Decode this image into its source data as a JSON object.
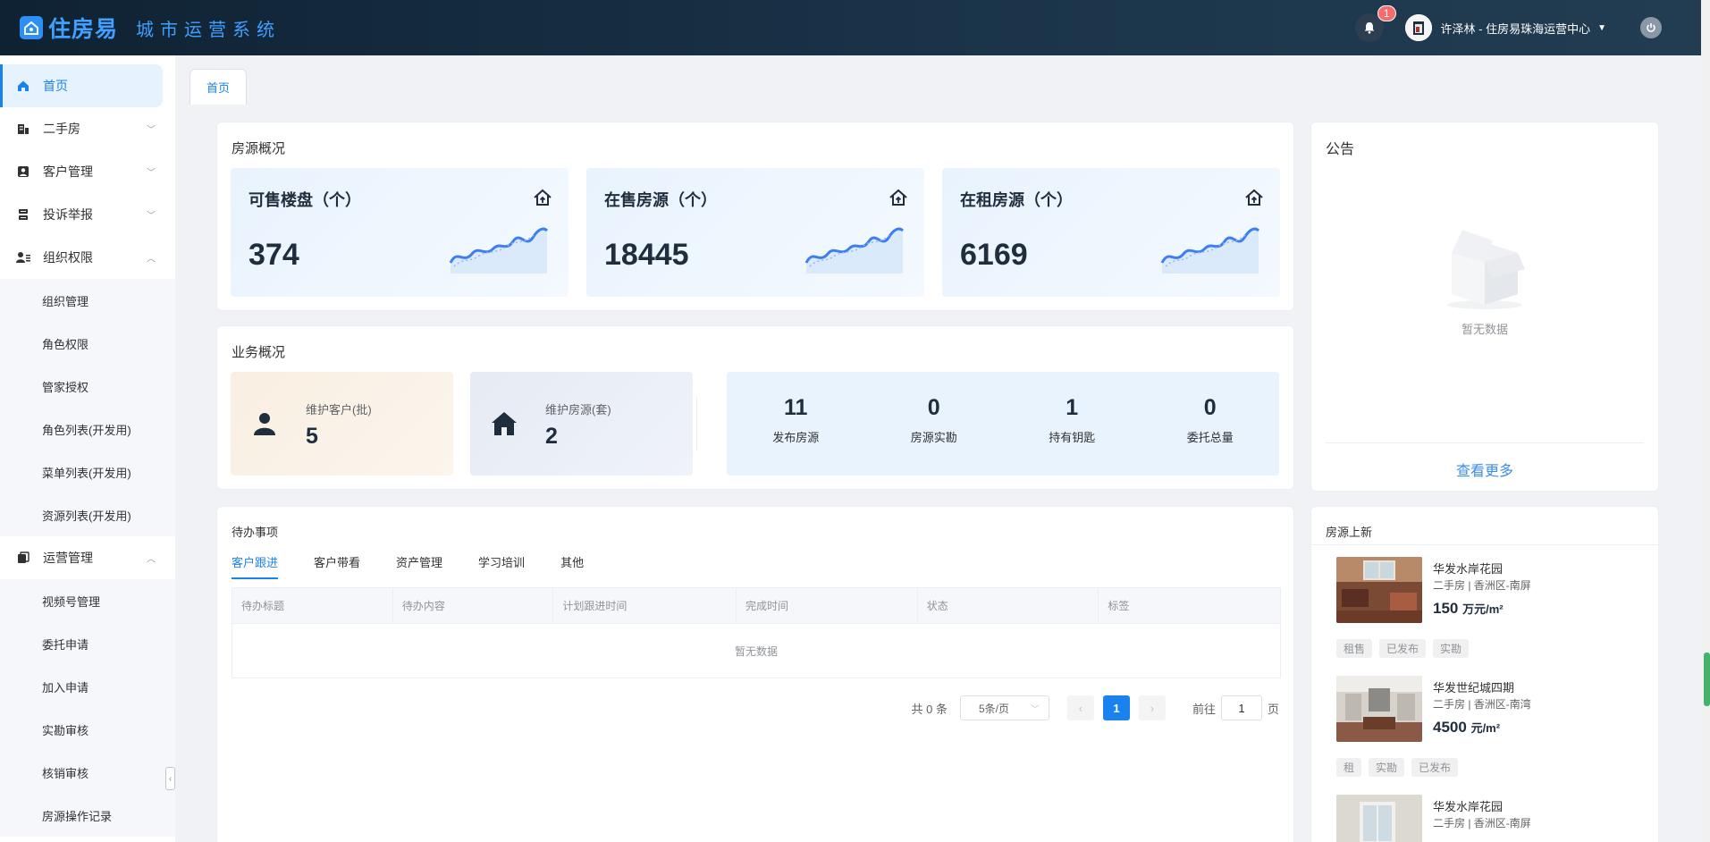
{
  "header": {
    "logo_text": "住房易",
    "system_name": "城市运营系统",
    "notification_count": "1",
    "user_label": "许泽林 - 住房易珠海运营中心"
  },
  "sidebar": {
    "items": [
      {
        "label": "首页",
        "icon": "home-icon",
        "active": true
      },
      {
        "label": "二手房",
        "icon": "building-icon"
      },
      {
        "label": "客户管理",
        "icon": "contact-card-icon"
      },
      {
        "label": "投诉举报",
        "icon": "complaint-icon"
      },
      {
        "label": "组织权限",
        "icon": "user-group-icon",
        "expanded": true
      }
    ],
    "org_sub": [
      "组织管理",
      "角色权限",
      "管家授权",
      "角色列表(开发用)",
      "菜单列表(开发用)",
      "资源列表(开发用)"
    ],
    "ops": {
      "label": "运营管理",
      "icon": "copy-icon"
    },
    "ops_sub": [
      "视频号管理",
      "委托申请",
      "加入申请",
      "实勘审核",
      "核销审核",
      "房源操作记录"
    ]
  },
  "tabs": {
    "home": "首页"
  },
  "house_overview": {
    "title": "房源概况",
    "cards": [
      {
        "label": "可售楼盘（个）",
        "value": "374"
      },
      {
        "label": "在售房源（个）",
        "value": "18445"
      },
      {
        "label": "在租房源（个）",
        "value": "6169"
      }
    ]
  },
  "business": {
    "title": "业务概况",
    "maintain_customers": {
      "label": "维护客户(批)",
      "value": "5"
    },
    "maintain_houses": {
      "label": "维护房源(套)",
      "value": "2"
    },
    "stats": [
      {
        "value": "11",
        "label": "发布房源"
      },
      {
        "value": "0",
        "label": "房源实勘"
      },
      {
        "value": "1",
        "label": "持有钥匙"
      },
      {
        "value": "0",
        "label": "委托总量"
      }
    ]
  },
  "todo": {
    "title": "待办事项",
    "tabs": [
      "客户跟进",
      "客户带看",
      "资产管理",
      "学习培训",
      "其他"
    ],
    "columns": [
      "待办标题",
      "待办内容",
      "计划跟进时间",
      "完成时间",
      "状态",
      "标签"
    ],
    "empty_text": "暂无数据",
    "pagination": {
      "total": "共 0 条",
      "page_size": "5条/页",
      "current": "1",
      "goto_label": "前往",
      "goto_value": "1",
      "page_suffix": "页"
    }
  },
  "notice": {
    "title": "公告",
    "empty_text": "暂无数据",
    "more": "查看更多"
  },
  "new_listings": {
    "title": "房源上新",
    "items": [
      {
        "name": "华发水岸花园",
        "sub": "二手房 | 香洲区-南屏",
        "price": "150",
        "unit": "万元/m²",
        "tags": [
          "租售",
          "已发布",
          "实勘"
        ]
      },
      {
        "name": "华发世纪城四期",
        "sub": "二手房 | 香洲区-南湾",
        "price": "4500",
        "unit": "元/m²",
        "tags": [
          "租",
          "实勘",
          "已发布"
        ]
      },
      {
        "name": "华发水岸花园",
        "sub": "二手房 | 香洲区-南屏"
      }
    ]
  }
}
